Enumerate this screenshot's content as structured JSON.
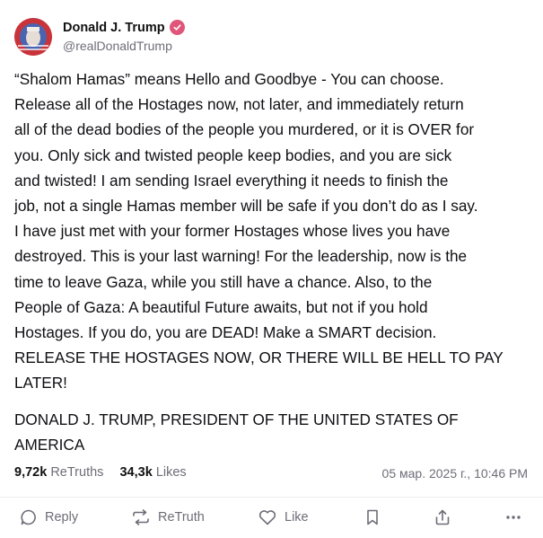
{
  "author": {
    "display_name": "Donald J. Trump",
    "handle": "@realDonaldTrump"
  },
  "post": {
    "text": "“Shalom Hamas” means Hello and Goodbye - You can choose.\nRelease all of the Hostages now, not later, and immediately return\nall of the dead bodies of the people you murdered, or it is OVER for\nyou. Only sick and twisted people keep bodies, and you are sick\nand twisted! I am sending Israel everything it needs to finish the\njob, not a single Hamas member will be safe if you don’t do as I say.\nI have just met with your former Hostages whose lives you have\ndestroyed. This is your last warning! For the leadership, now is the\ntime to leave Gaza, while you still have a chance. Also, to the\nPeople of Gaza: A beautiful Future awaits, but not if you hold\nHostages. If you do, you are DEAD! Make a SMART decision.\nRELEASE THE HOSTAGES NOW, OR THERE WILL BE HELL TO PAY\nLATER!",
    "signature": "DONALD J. TRUMP, PRESIDENT OF THE UNITED STATES OF AMERICA"
  },
  "stats": {
    "retruths_count": "9,72k",
    "retruths_label": "ReTruths",
    "likes_count": "34,3k",
    "likes_label": "Likes",
    "timestamp": "05 мар. 2025 г., 10:46 PM"
  },
  "actions": {
    "reply": "Reply",
    "retruth": "ReTruth",
    "like": "Like"
  },
  "colors": {
    "verified_badge": "#e0557a",
    "muted_text": "#6d6d78"
  },
  "icons": [
    "verified-icon",
    "reply-icon",
    "retruth-icon",
    "like-icon",
    "bookmark-icon",
    "share-icon",
    "more-icon"
  ]
}
